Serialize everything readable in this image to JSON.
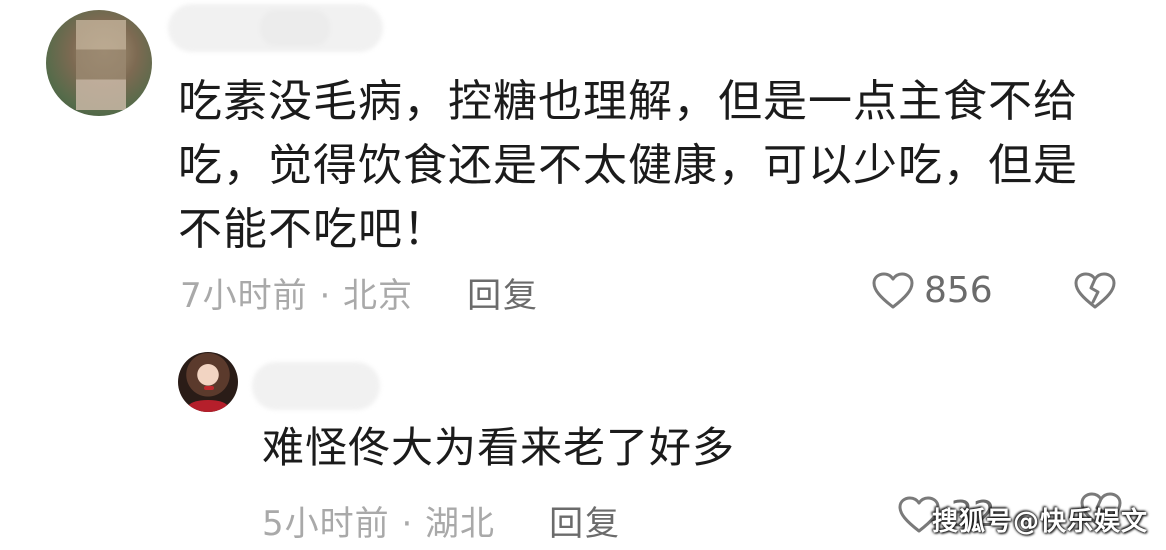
{
  "comment": {
    "text": "吃素没毛病，控糖也理解，但是一点主食不给\n吃，觉得饮食还是不太健康，可以少吃，但是\n不能不吃吧！",
    "time_location": "7小时前 · 北京",
    "reply_label": "回复",
    "like_count": "856"
  },
  "reply": {
    "text": "难怪佟大为看来老了好多",
    "time_location": "5小时前 · 湖北",
    "reply_label": "回复",
    "like_count": "32"
  },
  "watermark": "搜狐号@快乐娱文",
  "colors": {
    "meta_gray": "#a9a9a9",
    "action_gray": "#6b6b6b",
    "text": "#1b1b1b"
  },
  "icons": {
    "like": "heart-outline-icon",
    "dislike": "broken-heart-outline-icon"
  }
}
